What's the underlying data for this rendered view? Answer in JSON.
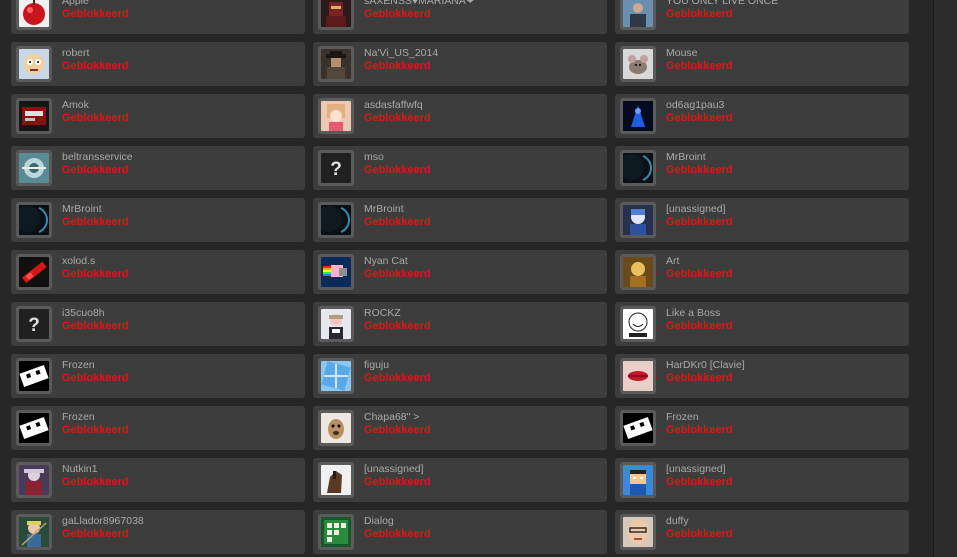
{
  "friends": [
    {
      "name": "Apple",
      "status": "Geblokkeerd",
      "avatar": "red-apple"
    },
    {
      "name": "sAXENSS♥MARIANA❤",
      "status": "Geblokkeerd",
      "avatar": "armored-soldier"
    },
    {
      "name": "YOU ONLY LIVE ONCE",
      "status": "Geblokkeerd",
      "avatar": "photo-person"
    },
    {
      "name": "robert",
      "status": "Geblokkeerd",
      "avatar": "cartoon-face"
    },
    {
      "name": "Na'Vi_US_2014",
      "status": "Geblokkeerd",
      "avatar": "cowboy"
    },
    {
      "name": "Mouse",
      "status": "Geblokkeerd",
      "avatar": "mouse"
    },
    {
      "name": "Amok",
      "status": "Geblokkeerd",
      "avatar": "game-box"
    },
    {
      "name": "asdasfaffwfq",
      "status": "Geblokkeerd",
      "avatar": "anime-girl"
    },
    {
      "name": "od6ag1pau3",
      "status": "Geblokkeerd",
      "avatar": "blue-figure"
    },
    {
      "name": "beltransservice",
      "status": "Geblokkeerd",
      "avatar": "spacecraft"
    },
    {
      "name": "mso",
      "status": "Geblokkeerd",
      "avatar": "question-mark"
    },
    {
      "name": "MrBroint",
      "status": "Geblokkeerd",
      "avatar": "dark-planet"
    },
    {
      "name": "MrBroint",
      "status": "Geblokkeerd",
      "avatar": "dark-planet"
    },
    {
      "name": "MrBroint",
      "status": "Geblokkeerd",
      "avatar": "dark-planet"
    },
    {
      "name": "[unassigned]",
      "status": "Geblokkeerd",
      "avatar": "blue-anime"
    },
    {
      "name": "xolod.s",
      "status": "Geblokkeerd",
      "avatar": "red-stick"
    },
    {
      "name": "Nyan Cat",
      "status": "Geblokkeerd",
      "avatar": "nyan-cat"
    },
    {
      "name": "Art",
      "status": "Geblokkeerd",
      "avatar": "golden-figure"
    },
    {
      "name": "i35cuo8h",
      "status": "Geblokkeerd",
      "avatar": "question-mark"
    },
    {
      "name": "ROCKZ",
      "status": "Geblokkeerd",
      "avatar": "pink-girl"
    },
    {
      "name": "Like a Boss",
      "status": "Geblokkeerd",
      "avatar": "meme-face"
    },
    {
      "name": "Frozen",
      "status": "Geblokkeerd",
      "avatar": "cube-face"
    },
    {
      "name": "figuju",
      "status": "Geblokkeerd",
      "avatar": "blue-tiles"
    },
    {
      "name": "HarDKr0 [Clavie]",
      "status": "Geblokkeerd",
      "avatar": "lips"
    },
    {
      "name": "Frozen",
      "status": "Geblokkeerd",
      "avatar": "cube-face"
    },
    {
      "name": "Chapa68\" >",
      "status": "Geblokkeerd",
      "avatar": "dog"
    },
    {
      "name": "Frozen",
      "status": "Geblokkeerd",
      "avatar": "cube-face"
    },
    {
      "name": "Nutkin1",
      "status": "Geblokkeerd",
      "avatar": "fantasy-warrior"
    },
    {
      "name": "[unassigned]",
      "status": "Geblokkeerd",
      "avatar": "horse"
    },
    {
      "name": "[unassigned]",
      "status": "Geblokkeerd",
      "avatar": "blocky-character"
    },
    {
      "name": "gaLlador8967038",
      "status": "Geblokkeerd",
      "avatar": "elf-archer"
    },
    {
      "name": "Dialog",
      "status": "Geblokkeerd",
      "avatar": "green-board"
    },
    {
      "name": "duffy",
      "status": "Geblokkeerd",
      "avatar": "man-face"
    }
  ],
  "colors": {
    "background": "#262626",
    "card": "#3d3d3d",
    "avatar_frame": "#5a5a5a",
    "name_text": "#a9a9a9",
    "status_text": "#e01515"
  }
}
